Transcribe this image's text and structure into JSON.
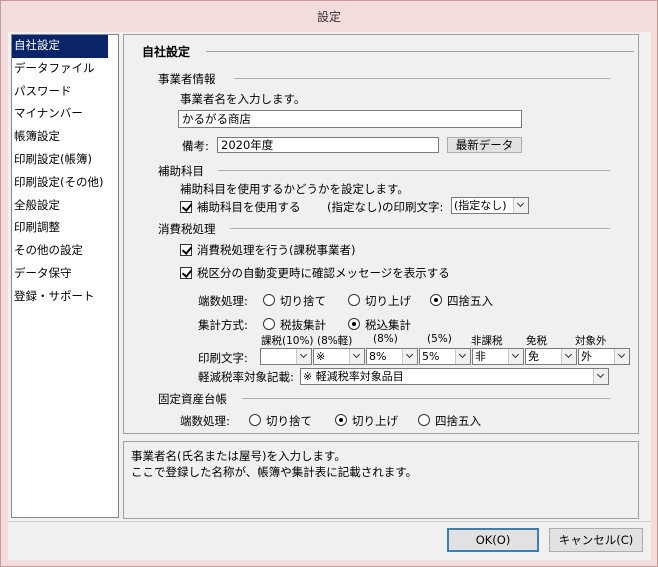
{
  "window": {
    "title": "設定"
  },
  "sidebar": {
    "items": [
      {
        "label": "自社設定",
        "selected": true
      },
      {
        "label": "データファイル"
      },
      {
        "label": "パスワード"
      },
      {
        "label": "マイナンバー"
      },
      {
        "label": "帳簿設定"
      },
      {
        "label": "印刷設定(帳簿)"
      },
      {
        "label": "印刷設定(その他)"
      },
      {
        "label": "全般設定"
      },
      {
        "label": "印刷調整"
      },
      {
        "label": "その他の設定"
      },
      {
        "label": "データ保守"
      },
      {
        "label": "登録・サポート"
      }
    ]
  },
  "panel": {
    "title": "自社設定",
    "business": {
      "header": "事業者情報",
      "instruction": "事業者名を入力します。",
      "name_value": "かるがる商店",
      "memo_label": "備考:",
      "memo_value": "2020年度",
      "latest_button": "最新データ"
    },
    "subject": {
      "header": "補助科目",
      "instruction": "補助科目を使用するかどうかを設定します。",
      "use_label": "補助科目を使用する",
      "print_label": "(指定なし)の印刷文字:",
      "print_value": "(指定なし)"
    },
    "tax": {
      "header": "消費税処理",
      "process_label": "消費税処理を行う(課税事業者)",
      "confirm_label": "税区分の自動変更時に確認メッセージを表示する",
      "rounding_label": "端数処理:",
      "rounding_options": [
        "切り捨て",
        "切り上げ",
        "四捨五入"
      ],
      "aggregate_label": "集計方式:",
      "aggregate_options": [
        "税抜集計",
        "税込集計"
      ],
      "columns": [
        "課税(10%)",
        "(8%軽)",
        "(8%)",
        "(5%)",
        "非課税",
        "免税",
        "対象外"
      ],
      "print_chars_label": "印刷文字:",
      "print_chars": [
        "",
        "※",
        "8%",
        "5%",
        "非",
        "免",
        "外"
      ],
      "reduced_label": "軽減税率対象記載:",
      "reduced_value": "※ 軽減税率対象品目"
    },
    "fixed_assets": {
      "header": "固定資産台帳",
      "rounding_label": "端数処理:",
      "rounding_options": [
        "切り捨て",
        "切り上げ",
        "四捨五入"
      ]
    }
  },
  "description": {
    "line1": "事業者名(氏名または屋号)を入力します。",
    "line2": "ここで登録した名称が、帳簿や集計表に記載されます。"
  },
  "footer": {
    "ok_label": "OK(O)",
    "cancel_label": "キャンセル(C)"
  }
}
